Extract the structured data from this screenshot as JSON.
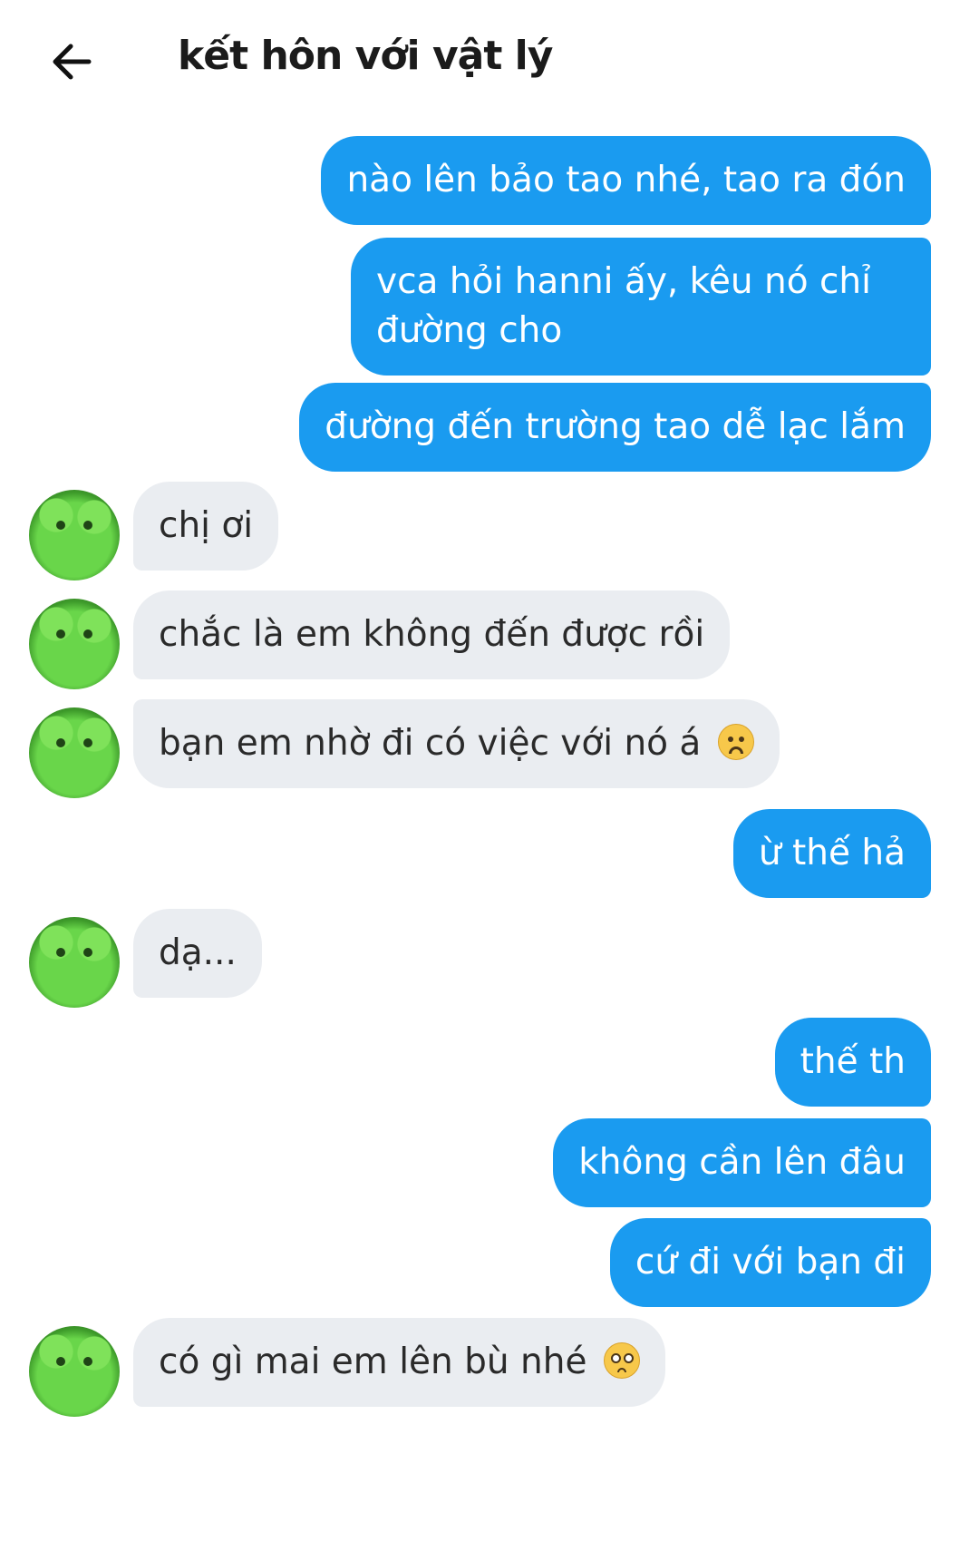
{
  "header": {
    "title": "kết hôn với vật lý"
  },
  "messages": [
    {
      "side": "out",
      "text": "nào lên bảo tao nhé, tao ra đón"
    },
    {
      "side": "out",
      "text": "vca hỏi hanni ấy, kêu nó chỉ đường cho"
    },
    {
      "side": "out",
      "text": "đường đến trường tao dễ lạc lắm"
    },
    {
      "side": "in",
      "text": "chị ơi"
    },
    {
      "side": "in",
      "text": "chắc là em không đến được rồi"
    },
    {
      "side": "in",
      "text": "bạn em nhờ đi có việc với nó á",
      "emoji": "frowning-face-emoji"
    },
    {
      "side": "out",
      "text": "ừ thế hả"
    },
    {
      "side": "in",
      "text": "dạ..."
    },
    {
      "side": "out",
      "text": "thế th"
    },
    {
      "side": "out",
      "text": "không cần lên đâu"
    },
    {
      "side": "out",
      "text": "cứ đi với bạn đi"
    },
    {
      "side": "in",
      "text": "có gì mai em lên bù nhé",
      "emoji": "pleading-face-emoji"
    }
  ],
  "colors": {
    "outgoing_bubble": "#1a9bf0",
    "incoming_bubble": "#eaedf1",
    "background": "#ffffff"
  }
}
